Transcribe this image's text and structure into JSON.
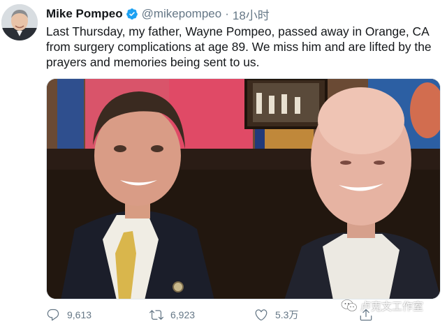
{
  "tweet": {
    "author_name": "Mike Pompeo",
    "handle": "@mikepompeo",
    "separator": "·",
    "time": "18小时",
    "text": "Last Thursday, my father, Wayne Pompeo, passed away in Orange, CA from surgery complications at age 89. We miss him and are lifted by the prayers and memories being sent to us."
  },
  "actions": {
    "replies": "9,613",
    "retweets": "6,923",
    "likes": "5.3万"
  },
  "watermark": {
    "text": "卢克文工作室"
  },
  "icons": {
    "verified": "verified-badge-icon",
    "reply": "reply-icon",
    "retweet": "retweet-icon",
    "like": "heart-icon",
    "share": "share-icon"
  },
  "colors": {
    "text": "#14171a",
    "secondary": "#657786",
    "verified": "#1da1f2"
  }
}
